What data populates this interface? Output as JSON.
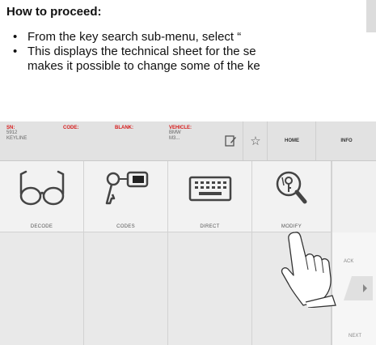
{
  "doc": {
    "heading": "How to proceed:",
    "bullets": [
      {
        "line1": "From the key search sub-menu, select “",
        "line2": ""
      },
      {
        "line1": "This displays the technical sheet for the se",
        "line2": "makes it possible to change some of the ke"
      }
    ],
    "bullet_char": "•"
  },
  "infobar": {
    "sn_label": "SN:",
    "sn_value1": "5912",
    "sn_value2": "KEYLINE",
    "code_label": "CODE:",
    "blank_label": "BLANK:",
    "vehicle_label": "VEHICLE:",
    "vehicle_value1": "BMW",
    "vehicle_value2": "M3...",
    "home_label": "HOME",
    "info_label": "INFO"
  },
  "tiles": {
    "decode": "DECODE",
    "codes": "CODES",
    "direct": "DIRECT",
    "modify": "MODIFY"
  },
  "side": {
    "back": "ACK",
    "next": "NEXT"
  },
  "colors": {
    "label_red": "#d61a1a",
    "tile_bg": "#f2f2f2",
    "bar_bg": "#e2e2e2"
  },
  "icons": [
    "glasses-icon",
    "key-tag-icon",
    "keyboard-icon",
    "key-magnifier-icon",
    "edit-icon",
    "star-icon",
    "pointing-hand-icon",
    "arrow-icon"
  ]
}
